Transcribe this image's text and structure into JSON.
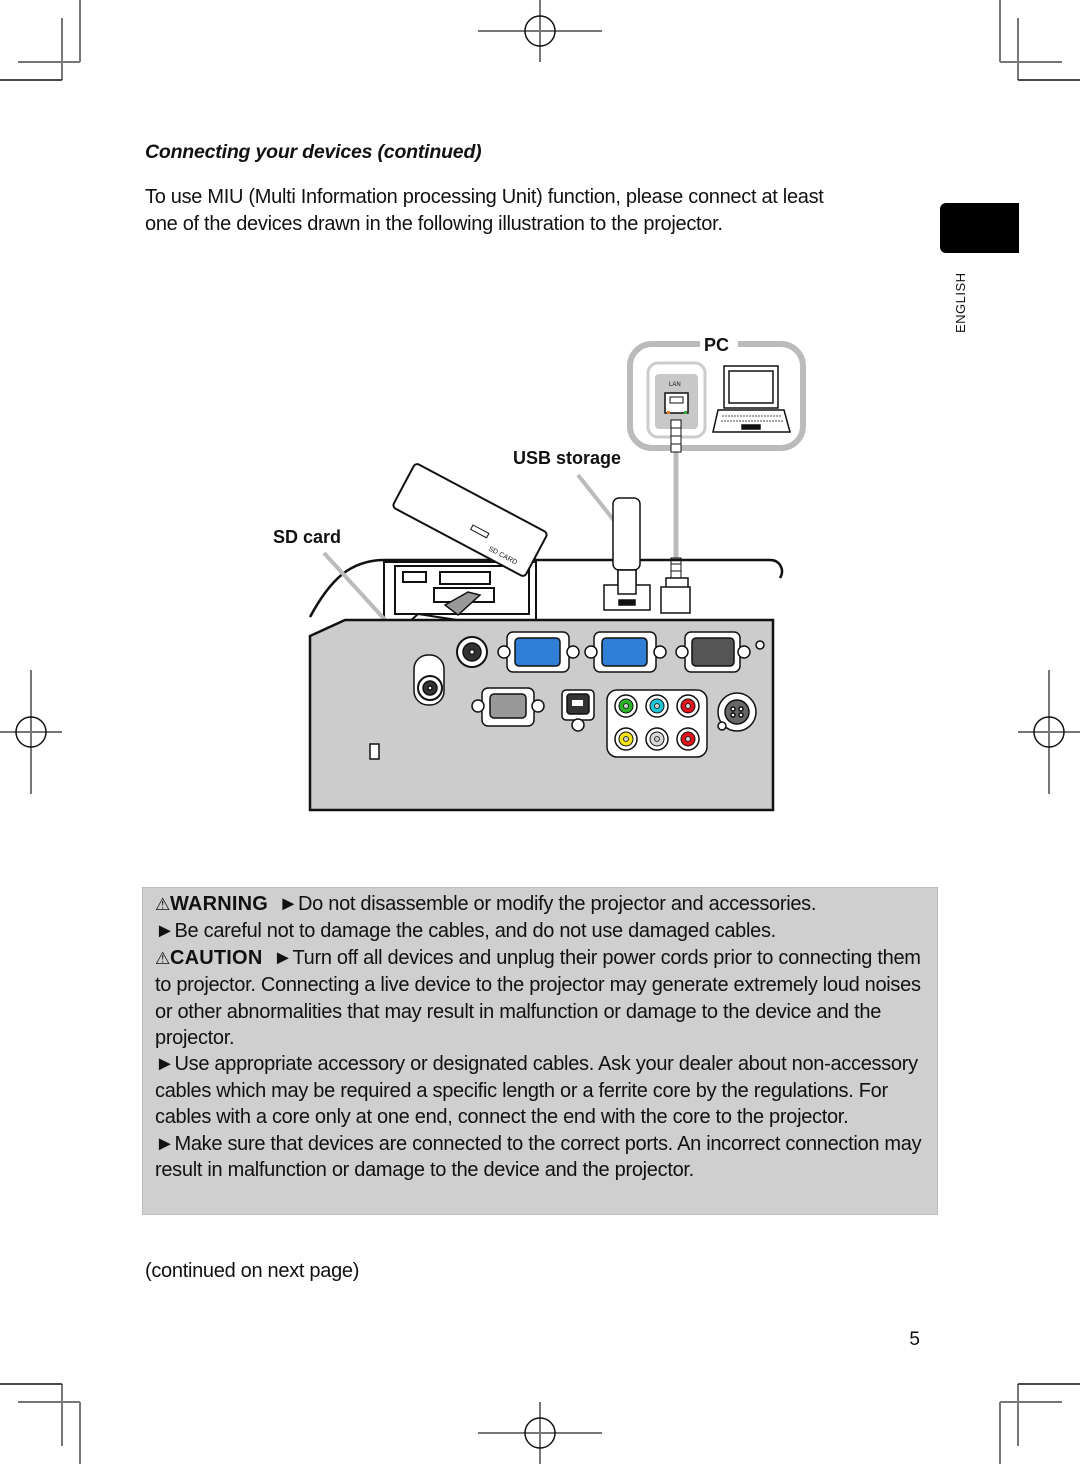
{
  "page": {
    "section_title": "Connecting your devices (continued)",
    "intro_lines": [
      "To use MIU (Multi Information processing Unit) function, please connect at least",
      "one of the devices drawn in the following illustration to the projector."
    ],
    "language_tab": "ENGLISH",
    "continued_note": "(continued on next page)",
    "page_number": "5"
  },
  "diagram": {
    "labels": {
      "pc": "PC",
      "lan_port": "LAN",
      "usb_storage": "USB storage",
      "sd_card": "SD card",
      "sd_card_text": "SD CARD"
    },
    "colors": {
      "panel_fill": "#cccccc",
      "vga_blue": "#2f7fd6",
      "rca_green": "#2bb42b",
      "rca_cyan": "#1fc8d8",
      "rca_red": "#e0141a",
      "rca_yellow": "#f2e21a",
      "rca_white": "#d8d8d8",
      "outline": "#111111",
      "frame_gray": "#bbbbbb"
    }
  },
  "warnings": {
    "warning_label": "WARNING",
    "warning_lines": [
      "►Do not disassemble or modify the projector and accessories.",
      "►Be careful not to damage the cables, and do not use damaged cables."
    ],
    "caution_label": "CAUTION",
    "caution_first": "►Turn off all devices and unplug their power cords prior to connecting them to projector. Connecting a live device to the projector may generate extremely loud noises or other abnormalities that may result in malfunction or damage to the device and the projector.",
    "caution_more": [
      "►Use appropriate accessory or designated cables. Ask your dealer about non-accessory cables which may be required a specific length or a ferrite core by the regulations. For cables with a core only at one end, connect the end with the core to the projector.",
      "►Make sure that devices are connected to the correct ports. An incorrect connection may result in malfunction or damage to the device and the projector."
    ],
    "triangle_icon": "⚠"
  }
}
